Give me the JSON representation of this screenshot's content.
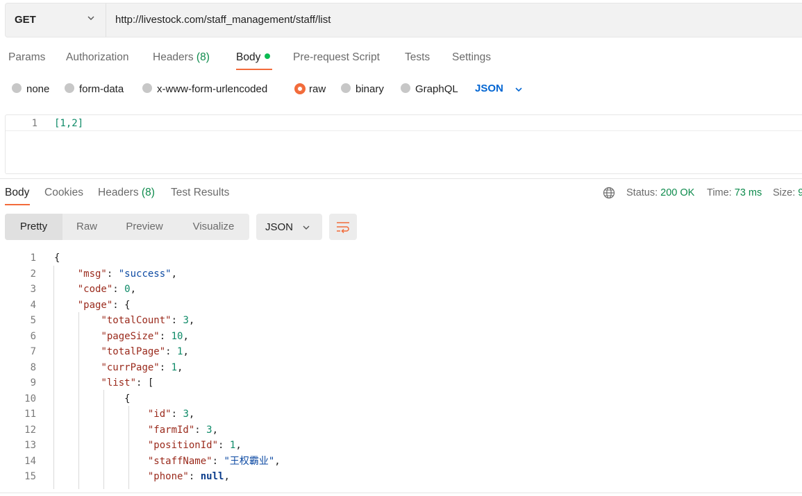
{
  "request": {
    "method": "GET",
    "url": "http://livestock.com/staff_management/staff/list"
  },
  "request_tabs": {
    "params": "Params",
    "authorization": "Authorization",
    "headers_label": "Headers",
    "headers_count": "(8)",
    "body": "Body",
    "prerequest": "Pre-request Script",
    "tests": "Tests",
    "settings": "Settings"
  },
  "body_types": {
    "none": "none",
    "form_data": "form-data",
    "urlencoded": "x-www-form-urlencoded",
    "raw": "raw",
    "binary": "binary",
    "graphql": "GraphQL",
    "selected_format": "JSON"
  },
  "request_editor": {
    "line_number": "1",
    "content": "[1,2]"
  },
  "response_tabs": {
    "body": "Body",
    "cookies": "Cookies",
    "headers_label": "Headers",
    "headers_count": "(8)",
    "test_results": "Test Results"
  },
  "response_status": {
    "status_label": "Status:",
    "status_value": "200 OK",
    "time_label": "Time:",
    "time_value": "73 ms",
    "size_label": "Size:",
    "size_value": "9"
  },
  "response_view": {
    "pretty": "Pretty",
    "raw": "Raw",
    "preview": "Preview",
    "visualize": "Visualize",
    "format": "JSON"
  },
  "response_lines": [
    {
      "n": "1",
      "text": "{"
    },
    {
      "n": "2",
      "text": "    \"msg\": \"success\","
    },
    {
      "n": "3",
      "text": "    \"code\": 0,"
    },
    {
      "n": "4",
      "text": "    \"page\": {"
    },
    {
      "n": "5",
      "text": "        \"totalCount\": 3,"
    },
    {
      "n": "6",
      "text": "        \"pageSize\": 10,"
    },
    {
      "n": "7",
      "text": "        \"totalPage\": 1,"
    },
    {
      "n": "8",
      "text": "        \"currPage\": 1,"
    },
    {
      "n": "9",
      "text": "        \"list\": ["
    },
    {
      "n": "10",
      "text": "            {"
    },
    {
      "n": "11",
      "text": "                \"id\": 3,"
    },
    {
      "n": "12",
      "text": "                \"farmId\": 3,"
    },
    {
      "n": "13",
      "text": "                \"positionId\": 1,"
    },
    {
      "n": "14",
      "text": "                \"staffName\": \"王权霸业\","
    },
    {
      "n": "15",
      "text": "                \"phone\": null,"
    }
  ],
  "colors": {
    "accent": "#f26b3a",
    "ok_green": "#0c8a4b",
    "json_blue": "#0265d2"
  }
}
